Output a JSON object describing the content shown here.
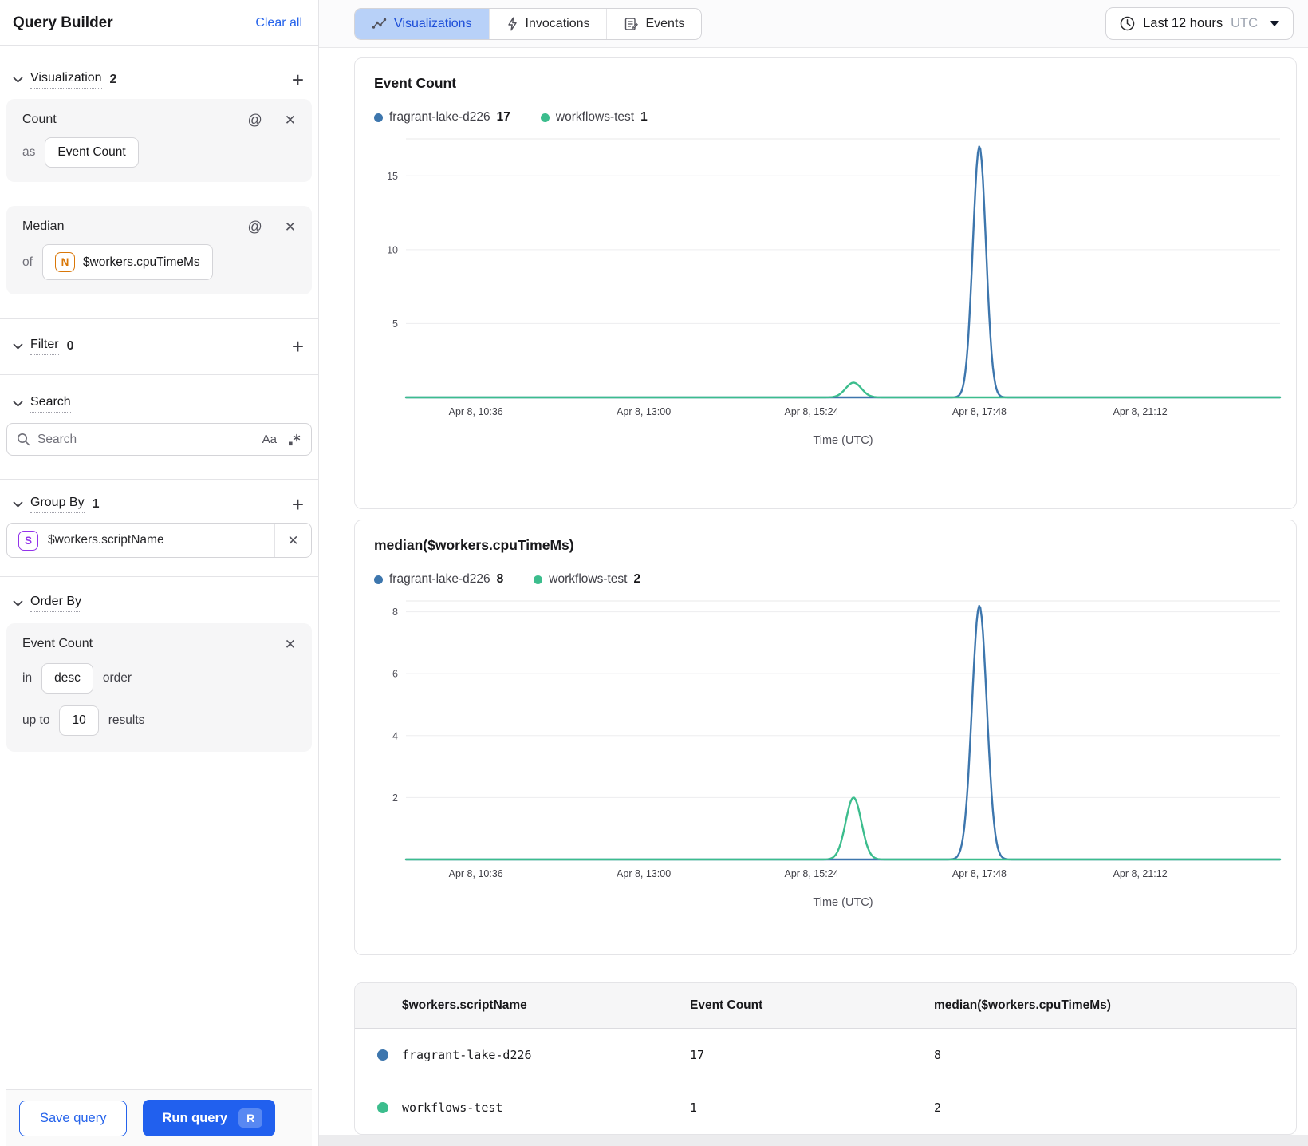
{
  "app": {
    "title": "Query Builder",
    "clear_all_label": "Clear all"
  },
  "sidebar": {
    "visualization": {
      "label": "Visualization",
      "count": "2",
      "cards": [
        {
          "title": "Count",
          "connector": "as",
          "value": "Event Count"
        },
        {
          "title": "Median",
          "connector": "of",
          "value": "$workers.cpuTimeMs",
          "type_badge": "N"
        }
      ]
    },
    "filter": {
      "label": "Filter",
      "count": "0"
    },
    "search": {
      "label": "Search",
      "placeholder": "Search",
      "case_toggle": "Aa"
    },
    "group_by": {
      "label": "Group By",
      "count": "1",
      "items": [
        {
          "type_badge": "S",
          "value": "$workers.scriptName"
        }
      ]
    },
    "order_by": {
      "label": "Order By",
      "card": {
        "field": "Event Count",
        "in_label": "in",
        "direction": "desc",
        "order_label": "order",
        "limit_label": "up to",
        "limit": "10",
        "results_label": "results"
      }
    },
    "footer": {
      "save_label": "Save query",
      "run_label": "Run query",
      "run_shortcut": "R"
    }
  },
  "header": {
    "tabs": [
      {
        "label": "Visualizations",
        "icon": "line-chart-icon",
        "active": true
      },
      {
        "label": "Invocations",
        "icon": "bolt-icon",
        "active": false
      },
      {
        "label": "Events",
        "icon": "note-icon",
        "active": false
      }
    ],
    "time_range": {
      "label": "Last 12 hours",
      "timezone": "UTC",
      "icon": "clock-icon"
    }
  },
  "colors": {
    "series_blue": "#3d76ad",
    "series_green": "#3cbd8d",
    "accent_blue": "#2563eb",
    "tab_active_bg": "#b8d1f8",
    "tab_active_text": "#1d4ed8"
  },
  "chart_data": [
    {
      "type": "line",
      "title": "Event Count",
      "xlabel": "Time (UTC)",
      "grid": true,
      "legend_position": "top",
      "legend": [
        {
          "name": "fragrant-lake-d226",
          "value": "17",
          "color": "#3d76ad"
        },
        {
          "name": "workflows-test",
          "value": "1",
          "color": "#3cbd8d"
        }
      ],
      "y_ticks": [
        5,
        10,
        15
      ],
      "ylim": [
        0,
        17.5
      ],
      "x_ticks": [
        {
          "label": "Apr 8, 10:36",
          "f": 0.08
        },
        {
          "label": "Apr 8, 13:00",
          "f": 0.272
        },
        {
          "label": "Apr 8, 15:24",
          "f": 0.464
        },
        {
          "label": "Apr 8, 17:48",
          "f": 0.656
        },
        {
          "label": "Apr 8, 21:12",
          "f": 0.84
        }
      ],
      "series": [
        {
          "name": "fragrant-lake-d226",
          "color": "#3d76ad",
          "baseline": 0,
          "peaks": [
            {
              "center_f": 0.656,
              "sigma_f": 0.0075,
              "value": 17
            }
          ],
          "notable_points": [
            {
              "time": "Apr 8, 17:48",
              "value": 17
            }
          ]
        },
        {
          "name": "workflows-test",
          "color": "#3cbd8d",
          "baseline": 0,
          "peaks": [
            {
              "center_f": 0.512,
              "sigma_f": 0.009,
              "value": 1
            }
          ],
          "notable_points": [
            {
              "time": "Apr 8, 16:00",
              "value": 1
            }
          ]
        }
      ]
    },
    {
      "type": "line",
      "title": "median($workers.cpuTimeMs)",
      "xlabel": "Time (UTC)",
      "grid": true,
      "legend_position": "top",
      "legend": [
        {
          "name": "fragrant-lake-d226",
          "value": "8",
          "color": "#3d76ad"
        },
        {
          "name": "workflows-test",
          "value": "2",
          "color": "#3cbd8d"
        }
      ],
      "y_ticks": [
        2,
        4,
        6,
        8
      ],
      "ylim": [
        0,
        8.35
      ],
      "x_ticks": [
        {
          "label": "Apr 8, 10:36",
          "f": 0.08
        },
        {
          "label": "Apr 8, 13:00",
          "f": 0.272
        },
        {
          "label": "Apr 8, 15:24",
          "f": 0.464
        },
        {
          "label": "Apr 8, 17:48",
          "f": 0.656
        },
        {
          "label": "Apr 8, 21:12",
          "f": 0.84
        }
      ],
      "series": [
        {
          "name": "fragrant-lake-d226",
          "color": "#3d76ad",
          "baseline": 0,
          "peaks": [
            {
              "center_f": 0.656,
              "sigma_f": 0.0085,
              "value": 8.2
            }
          ],
          "notable_points": [
            {
              "time": "Apr 8, 17:48",
              "value": 8
            }
          ]
        },
        {
          "name": "workflows-test",
          "color": "#3cbd8d",
          "baseline": 0,
          "peaks": [
            {
              "center_f": 0.512,
              "sigma_f": 0.009,
              "value": 2
            }
          ],
          "notable_points": [
            {
              "time": "Apr 8, 16:00",
              "value": 2
            }
          ]
        }
      ]
    }
  ],
  "table": {
    "columns": [
      "$workers.scriptName",
      "Event Count",
      "median($workers.cpuTimeMs)"
    ],
    "rows": [
      {
        "color": "#3d76ad",
        "script_name": "fragrant-lake-d226",
        "event_count": "17",
        "median": "8"
      },
      {
        "color": "#3cbd8d",
        "script_name": "workflows-test",
        "event_count": "1",
        "median": "2"
      }
    ]
  }
}
